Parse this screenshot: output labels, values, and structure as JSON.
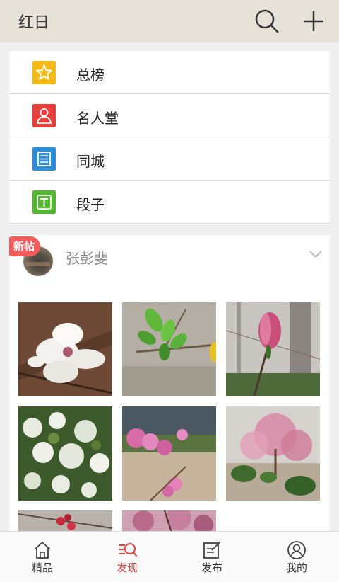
{
  "header": {
    "title": "红日",
    "search_icon": "search-icon",
    "add_icon": "plus-icon"
  },
  "menu": [
    {
      "label": "总榜",
      "icon": "star-icon",
      "color": "#f5b914"
    },
    {
      "label": "名人堂",
      "icon": "person-icon",
      "color": "#e8403a"
    },
    {
      "label": "同城",
      "icon": "list-icon",
      "color": "#2a8fd8"
    },
    {
      "label": "段子",
      "icon": "text-t-icon",
      "color": "#52b830"
    }
  ],
  "post": {
    "badge": "新帖",
    "author": "张彭斐",
    "photos": [
      "white magnolia",
      "green buds",
      "pink magnolia",
      "white blossoms",
      "pink peach blossoms",
      "pink blossom tree",
      "red buds",
      "pink tree"
    ]
  },
  "tabbar": [
    {
      "label": "精品",
      "icon": "home-icon",
      "active": false
    },
    {
      "label": "发现",
      "icon": "discover-icon",
      "active": true
    },
    {
      "label": "发布",
      "icon": "edit-icon",
      "active": false
    },
    {
      "label": "我的",
      "icon": "profile-icon",
      "active": false
    }
  ],
  "colors": {
    "accent": "#e0413a",
    "header_bg": "#e6e2d8",
    "badge": "#f25c5c"
  }
}
